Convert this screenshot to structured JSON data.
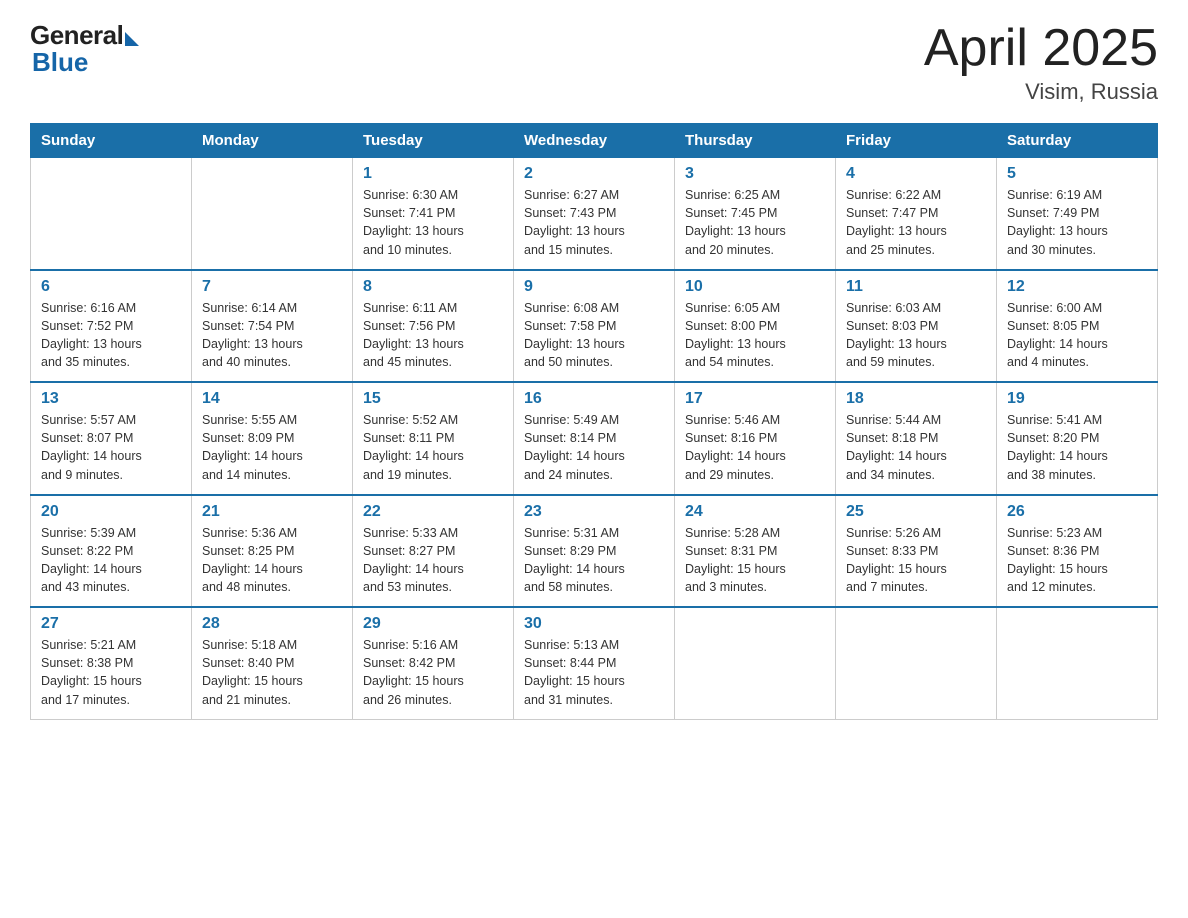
{
  "header": {
    "logo_general": "General",
    "logo_blue": "Blue",
    "title": "April 2025",
    "location": "Visim, Russia"
  },
  "days_of_week": [
    "Sunday",
    "Monday",
    "Tuesday",
    "Wednesday",
    "Thursday",
    "Friday",
    "Saturday"
  ],
  "weeks": [
    [
      {
        "day": "",
        "info": ""
      },
      {
        "day": "",
        "info": ""
      },
      {
        "day": "1",
        "info": "Sunrise: 6:30 AM\nSunset: 7:41 PM\nDaylight: 13 hours\nand 10 minutes."
      },
      {
        "day": "2",
        "info": "Sunrise: 6:27 AM\nSunset: 7:43 PM\nDaylight: 13 hours\nand 15 minutes."
      },
      {
        "day": "3",
        "info": "Sunrise: 6:25 AM\nSunset: 7:45 PM\nDaylight: 13 hours\nand 20 minutes."
      },
      {
        "day": "4",
        "info": "Sunrise: 6:22 AM\nSunset: 7:47 PM\nDaylight: 13 hours\nand 25 minutes."
      },
      {
        "day": "5",
        "info": "Sunrise: 6:19 AM\nSunset: 7:49 PM\nDaylight: 13 hours\nand 30 minutes."
      }
    ],
    [
      {
        "day": "6",
        "info": "Sunrise: 6:16 AM\nSunset: 7:52 PM\nDaylight: 13 hours\nand 35 minutes."
      },
      {
        "day": "7",
        "info": "Sunrise: 6:14 AM\nSunset: 7:54 PM\nDaylight: 13 hours\nand 40 minutes."
      },
      {
        "day": "8",
        "info": "Sunrise: 6:11 AM\nSunset: 7:56 PM\nDaylight: 13 hours\nand 45 minutes."
      },
      {
        "day": "9",
        "info": "Sunrise: 6:08 AM\nSunset: 7:58 PM\nDaylight: 13 hours\nand 50 minutes."
      },
      {
        "day": "10",
        "info": "Sunrise: 6:05 AM\nSunset: 8:00 PM\nDaylight: 13 hours\nand 54 minutes."
      },
      {
        "day": "11",
        "info": "Sunrise: 6:03 AM\nSunset: 8:03 PM\nDaylight: 13 hours\nand 59 minutes."
      },
      {
        "day": "12",
        "info": "Sunrise: 6:00 AM\nSunset: 8:05 PM\nDaylight: 14 hours\nand 4 minutes."
      }
    ],
    [
      {
        "day": "13",
        "info": "Sunrise: 5:57 AM\nSunset: 8:07 PM\nDaylight: 14 hours\nand 9 minutes."
      },
      {
        "day": "14",
        "info": "Sunrise: 5:55 AM\nSunset: 8:09 PM\nDaylight: 14 hours\nand 14 minutes."
      },
      {
        "day": "15",
        "info": "Sunrise: 5:52 AM\nSunset: 8:11 PM\nDaylight: 14 hours\nand 19 minutes."
      },
      {
        "day": "16",
        "info": "Sunrise: 5:49 AM\nSunset: 8:14 PM\nDaylight: 14 hours\nand 24 minutes."
      },
      {
        "day": "17",
        "info": "Sunrise: 5:46 AM\nSunset: 8:16 PM\nDaylight: 14 hours\nand 29 minutes."
      },
      {
        "day": "18",
        "info": "Sunrise: 5:44 AM\nSunset: 8:18 PM\nDaylight: 14 hours\nand 34 minutes."
      },
      {
        "day": "19",
        "info": "Sunrise: 5:41 AM\nSunset: 8:20 PM\nDaylight: 14 hours\nand 38 minutes."
      }
    ],
    [
      {
        "day": "20",
        "info": "Sunrise: 5:39 AM\nSunset: 8:22 PM\nDaylight: 14 hours\nand 43 minutes."
      },
      {
        "day": "21",
        "info": "Sunrise: 5:36 AM\nSunset: 8:25 PM\nDaylight: 14 hours\nand 48 minutes."
      },
      {
        "day": "22",
        "info": "Sunrise: 5:33 AM\nSunset: 8:27 PM\nDaylight: 14 hours\nand 53 minutes."
      },
      {
        "day": "23",
        "info": "Sunrise: 5:31 AM\nSunset: 8:29 PM\nDaylight: 14 hours\nand 58 minutes."
      },
      {
        "day": "24",
        "info": "Sunrise: 5:28 AM\nSunset: 8:31 PM\nDaylight: 15 hours\nand 3 minutes."
      },
      {
        "day": "25",
        "info": "Sunrise: 5:26 AM\nSunset: 8:33 PM\nDaylight: 15 hours\nand 7 minutes."
      },
      {
        "day": "26",
        "info": "Sunrise: 5:23 AM\nSunset: 8:36 PM\nDaylight: 15 hours\nand 12 minutes."
      }
    ],
    [
      {
        "day": "27",
        "info": "Sunrise: 5:21 AM\nSunset: 8:38 PM\nDaylight: 15 hours\nand 17 minutes."
      },
      {
        "day": "28",
        "info": "Sunrise: 5:18 AM\nSunset: 8:40 PM\nDaylight: 15 hours\nand 21 minutes."
      },
      {
        "day": "29",
        "info": "Sunrise: 5:16 AM\nSunset: 8:42 PM\nDaylight: 15 hours\nand 26 minutes."
      },
      {
        "day": "30",
        "info": "Sunrise: 5:13 AM\nSunset: 8:44 PM\nDaylight: 15 hours\nand 31 minutes."
      },
      {
        "day": "",
        "info": ""
      },
      {
        "day": "",
        "info": ""
      },
      {
        "day": "",
        "info": ""
      }
    ]
  ]
}
